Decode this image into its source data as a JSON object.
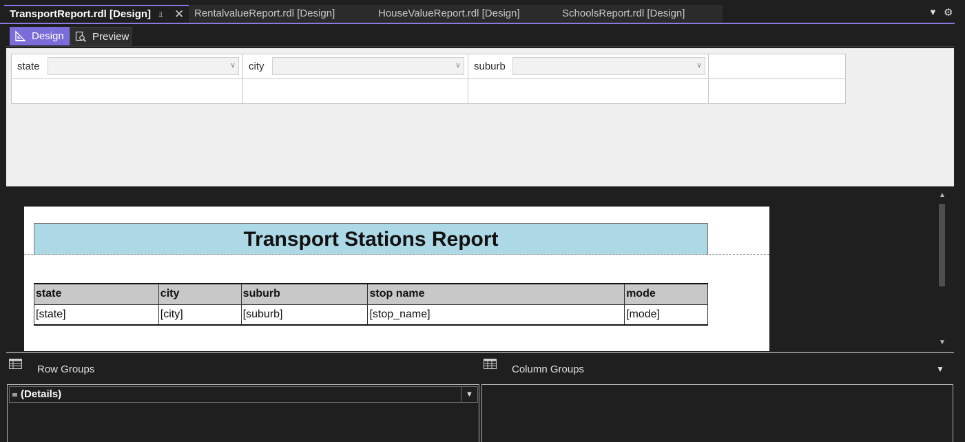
{
  "tabs": [
    {
      "label": "TransportReport.rdl [Design]",
      "active": true
    },
    {
      "label": "RentalvalueReport.rdl [Design]",
      "active": false
    },
    {
      "label": "HouseValueReport.rdl [Design]",
      "active": false
    },
    {
      "label": "SchoolsReport.rdl [Design]",
      "active": false
    }
  ],
  "tab_controls": {
    "pin_icon": "pin-icon",
    "close_icon": "close-icon",
    "dropdown_icon": "chevron-down-icon",
    "settings_icon": "gear-icon"
  },
  "mode_bar": {
    "design_label": "Design",
    "preview_label": "Preview"
  },
  "parameters": [
    {
      "label": "state",
      "value": ""
    },
    {
      "label": "city",
      "value": ""
    },
    {
      "label": "suburb",
      "value": ""
    }
  ],
  "report": {
    "title": "Transport Stations Report",
    "columns": [
      "state",
      "city",
      "suburb",
      "stop name",
      "mode"
    ],
    "details": [
      "[state]",
      "[city]",
      "[suburb]",
      "[stop_name]",
      "[mode]"
    ]
  },
  "grouping": {
    "row_groups_label": "Row Groups",
    "column_groups_label": "Column Groups",
    "row_group_items": [
      "(Details)"
    ]
  },
  "colors": {
    "accent": "#8a7ae6",
    "title_band": "#add8e6",
    "header_row": "#c8c8c8"
  }
}
